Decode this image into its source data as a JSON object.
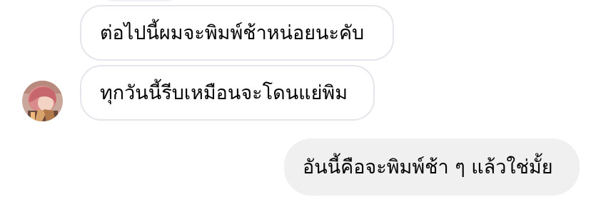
{
  "conversation": {
    "messages": [
      {
        "direction": "received",
        "text": "ต่อไปนี้ผมจะพิมพ์ช้าหน่อยนะคับ"
      },
      {
        "direction": "received",
        "text": "ทุกวันนี้รีบเหมือนจะโดนแย่พิม"
      },
      {
        "direction": "sent",
        "text": "อันนี้คือจะพิมพ์ช้า ๆ แล้วใช่มั้ย"
      }
    ],
    "avatar": {
      "icon": "user-avatar-illustration"
    },
    "colors": {
      "received_bg": "#ffffff",
      "received_border": "#e4e6eb",
      "sent_bg": "#f0f0f0",
      "text": "#050505"
    }
  }
}
